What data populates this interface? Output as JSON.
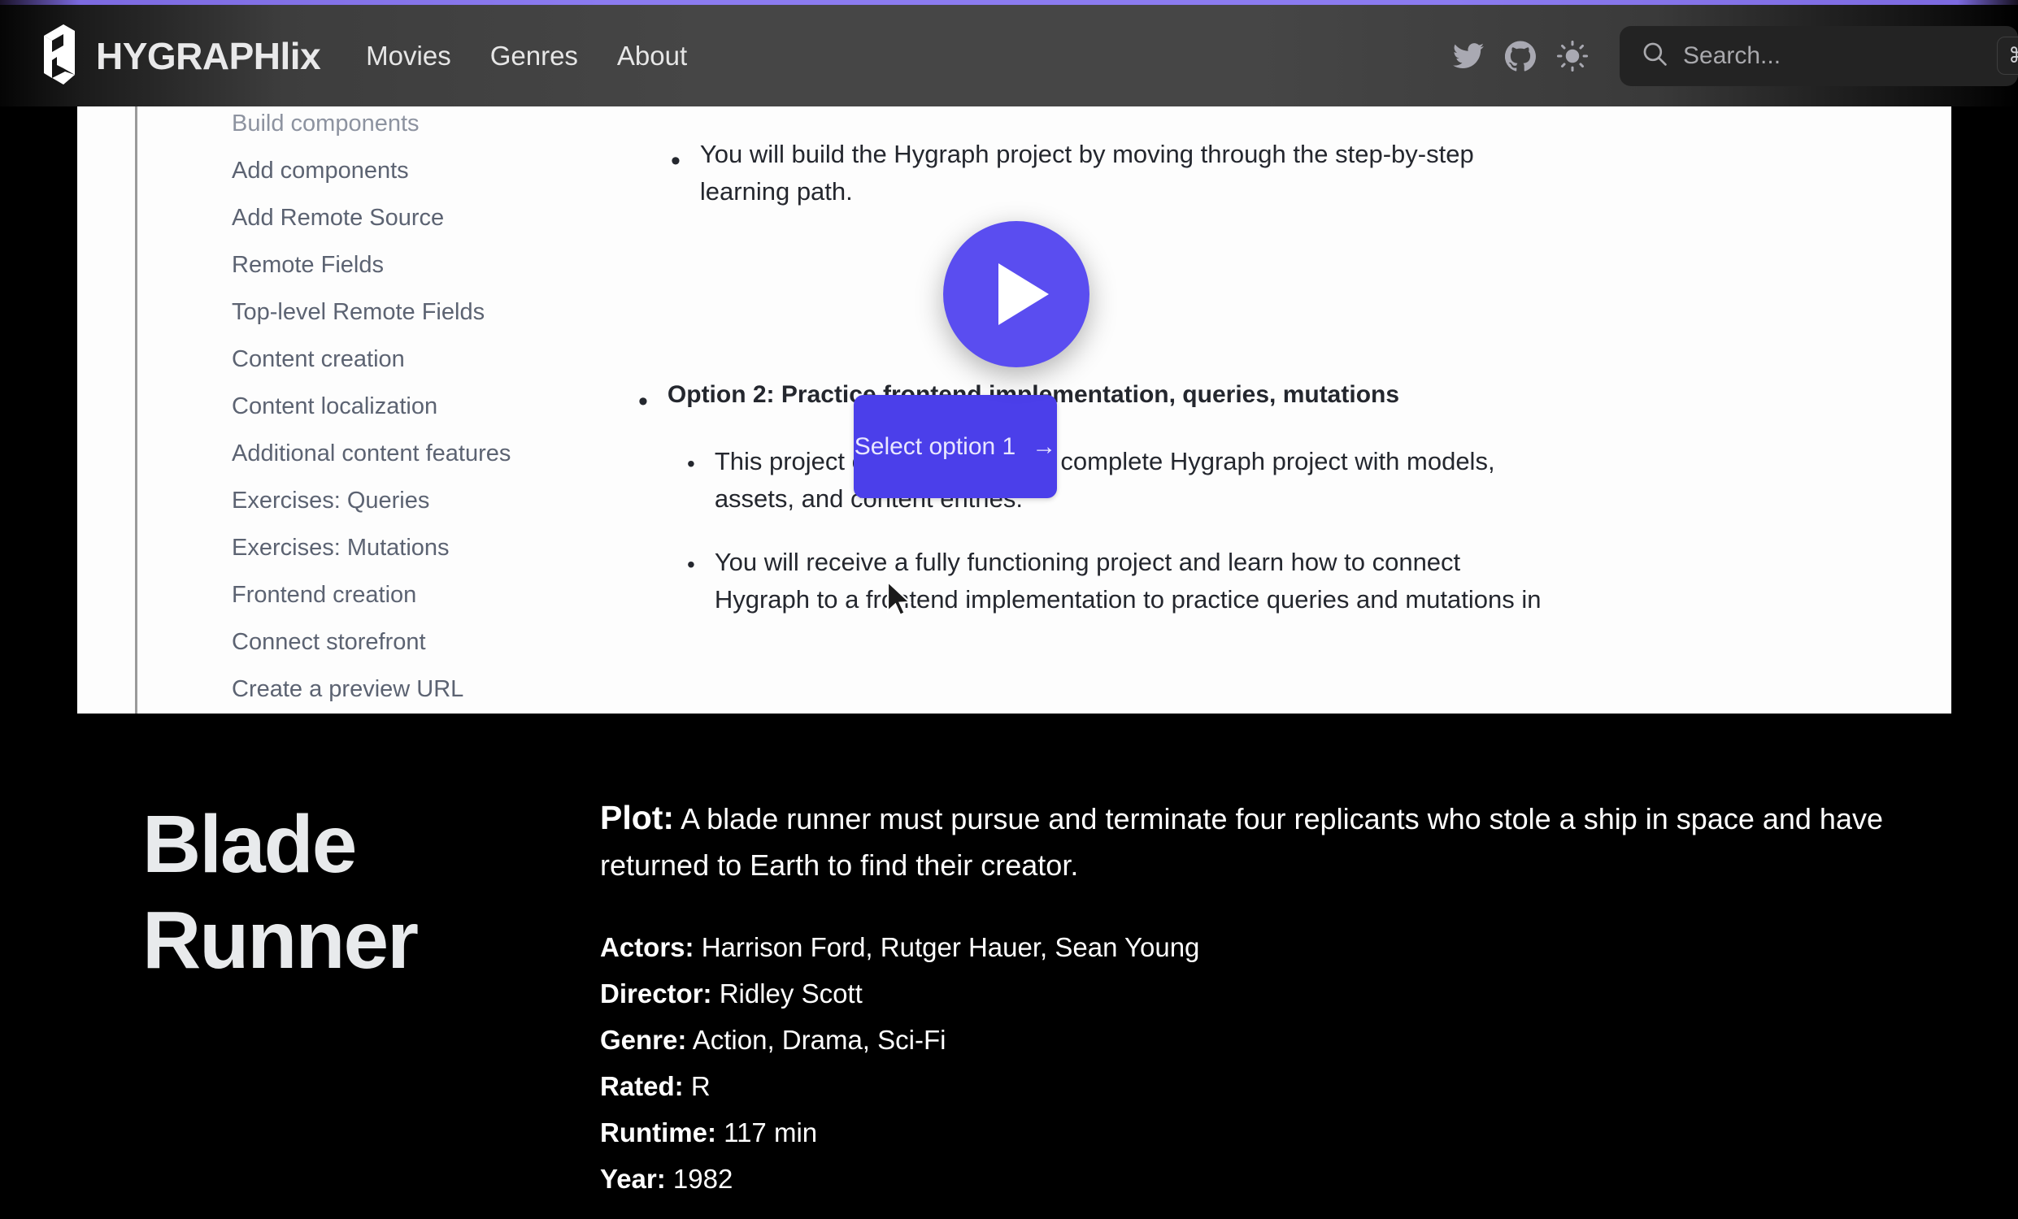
{
  "header": {
    "brand_name": "HYGRAPHlix",
    "logo_icon": "hygraph-logo-icon",
    "nav": [
      {
        "label": "Movies"
      },
      {
        "label": "Genres"
      },
      {
        "label": "About"
      }
    ],
    "icons": [
      {
        "name": "twitter-icon"
      },
      {
        "name": "github-icon"
      },
      {
        "name": "theme-toggle-sun-icon"
      }
    ],
    "search": {
      "placeholder": "Search...",
      "value": "",
      "shortcut": "⌘ K",
      "icon": "search-icon"
    }
  },
  "video": {
    "play_icon": "play-icon",
    "cursor_icon": "mouse-cursor-icon",
    "toc": [
      "Build components",
      "Add components",
      "Add Remote Source",
      "Remote Fields",
      "Top-level Remote Fields",
      "Content creation",
      "Content localization",
      "Additional content features",
      "Exercises: Queries",
      "Exercises: Mutations",
      "Frontend creation",
      "Connect storefront",
      "Create a preview URL"
    ],
    "bullets": [
      {
        "level": 1,
        "bold": false,
        "text": "You will build the Hygraph project by moving through the step-by-step learning path."
      },
      {
        "level": 1,
        "bold": true,
        "text": "Option 2: Practice frontend implementation, queries, mutations"
      },
      {
        "level": 2,
        "bold": false,
        "text": "This project clone includes the complete Hygraph project with models, assets, and content entries."
      },
      {
        "level": 2,
        "bold": false,
        "text": "You will receive a fully functioning project and learn how to connect Hygraph to a frontend implementation to practice queries and mutations in"
      }
    ],
    "cta": {
      "label": "Select option 1",
      "arrow": "→"
    }
  },
  "movie": {
    "title": "Blade Runner",
    "plot_label": "Plot:",
    "plot": "A blade runner must pursue and terminate four replicants who stole a ship in space and have returned to Earth to find their creator.",
    "meta": [
      {
        "label": "Actors:",
        "value": "Harrison Ford, Rutger Hauer, Sean Young"
      },
      {
        "label": "Director:",
        "value": "Ridley Scott"
      },
      {
        "label": "Genre:",
        "value": "Action, Drama, Sci-Fi"
      },
      {
        "label": "Rated:",
        "value": "R"
      },
      {
        "label": "Runtime:",
        "value": "117 min"
      },
      {
        "label": "Year:",
        "value": "1982"
      }
    ]
  },
  "colors": {
    "accent_purple": "#8b7bf0",
    "play_button": "#5a4df0",
    "cta_button": "#4b3fea",
    "page_background": "#000000",
    "header_gradient_mid": "#464646",
    "search_background": "#232323"
  }
}
